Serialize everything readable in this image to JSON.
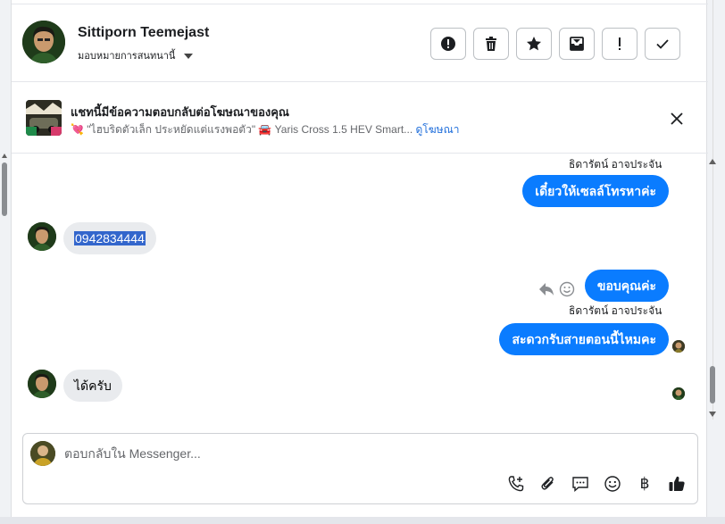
{
  "header": {
    "contact_name": "Sittiporn Teemejast",
    "assign_label": "มอบหมายการสนทนานี้",
    "tools": [
      {
        "name": "report-spam-icon",
        "glyph": "!"
      },
      {
        "name": "trash-icon",
        "glyph": ""
      },
      {
        "name": "star-icon",
        "glyph": ""
      },
      {
        "name": "mark-unread-icon",
        "glyph": ""
      },
      {
        "name": "follow-up-icon",
        "glyph": "!"
      },
      {
        "name": "done-check-icon",
        "glyph": ""
      }
    ]
  },
  "ad_banner": {
    "title": "แชทนี้มีข้อความตอบกลับต่อโฆษณาของคุณ",
    "prefix_emoji": "💘",
    "subtitle": "\"ไฮบริดตัวเล็ก ประหยัดแต่แรงพอตัว\" 🚘 Yaris Cross 1.5 HEV Smart...",
    "link_label": "ดูโฆษณา"
  },
  "messages": [
    {
      "type": "label",
      "text": "ธิดารัตน์ อาจประจัน"
    },
    {
      "type": "out",
      "text": "เดี๋ยวให้เซลล์โทรหาค่ะ"
    },
    {
      "type": "in",
      "text": "0942834444",
      "selected": true
    },
    {
      "type": "out",
      "text": "ขอบคุณค่ะ"
    },
    {
      "type": "label",
      "text": "ธิดารัตน์ อาจประจัน"
    },
    {
      "type": "out",
      "text": "สะดวกรับสายตอนนี้ไหมคะ"
    },
    {
      "type": "in",
      "text": "ได้ครับ"
    }
  ],
  "composer": {
    "placeholder": "ตอบกลับใน Messenger...",
    "tools": [
      "call-add-icon",
      "attachment-icon",
      "saved-reply-icon",
      "emoji-icon",
      "baht-payment-icon",
      "like-icon"
    ],
    "baht_glyph": "฿"
  },
  "colors": {
    "outgoing_bubble": "#0a7cff",
    "incoming_bubble": "#e9ebee",
    "link": "#216fdb"
  }
}
